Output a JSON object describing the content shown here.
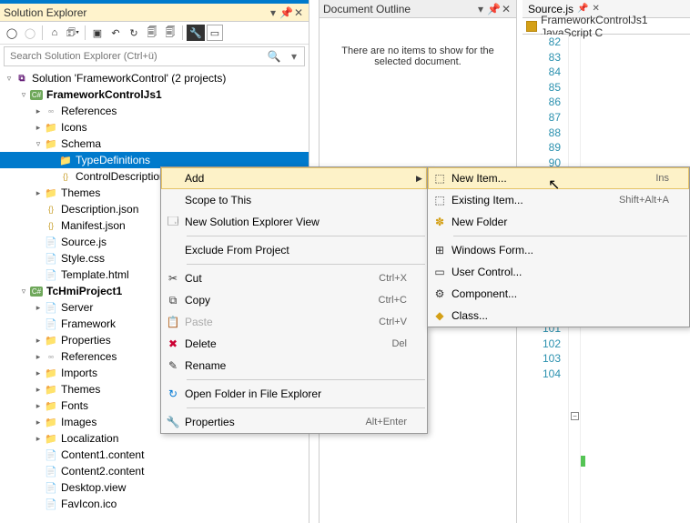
{
  "solutionExplorer": {
    "title": "Solution Explorer",
    "searchPlaceholder": "Search Solution Explorer (Ctrl+ü)",
    "solutionLabel": "Solution 'FrameworkControl' (2 projects)",
    "tree": [
      {
        "indent": 1,
        "exp": "▿",
        "iconClass": "proj-icon",
        "label": "FrameworkControlJs1",
        "bold": true
      },
      {
        "indent": 2,
        "exp": "▸",
        "iconClass": "ref-icon",
        "label": "References"
      },
      {
        "indent": 2,
        "exp": "▸",
        "iconClass": "folder-icon",
        "label": "Icons"
      },
      {
        "indent": 2,
        "exp": "▿",
        "iconClass": "folder-icon",
        "label": "Schema"
      },
      {
        "indent": 3,
        "exp": "",
        "iconClass": "folder-icon",
        "label": "TypeDefinitions",
        "selected": true
      },
      {
        "indent": 3,
        "exp": "",
        "iconClass": "brace-icon",
        "label": "ControlDescription"
      },
      {
        "indent": 2,
        "exp": "▸",
        "iconClass": "folder-icon",
        "label": "Themes"
      },
      {
        "indent": 2,
        "exp": "",
        "iconClass": "brace-icon",
        "label": "Description.json"
      },
      {
        "indent": 2,
        "exp": "",
        "iconClass": "brace-icon",
        "label": "Manifest.json"
      },
      {
        "indent": 2,
        "exp": "",
        "iconClass": "file-icon",
        "label": "Source.js"
      },
      {
        "indent": 2,
        "exp": "",
        "iconClass": "file-icon",
        "label": "Style.css"
      },
      {
        "indent": 2,
        "exp": "",
        "iconClass": "file-icon",
        "label": "Template.html"
      },
      {
        "indent": 1,
        "exp": "▿",
        "iconClass": "proj-icon",
        "label": "TcHmiProject1",
        "bold": true
      },
      {
        "indent": 2,
        "exp": "▸",
        "iconClass": "file-icon",
        "label": "Server"
      },
      {
        "indent": 2,
        "exp": "",
        "iconClass": "file-icon",
        "label": "Framework"
      },
      {
        "indent": 2,
        "exp": "▸",
        "iconClass": "folder-icon",
        "label": "Properties"
      },
      {
        "indent": 2,
        "exp": "▸",
        "iconClass": "ref-icon",
        "label": "References"
      },
      {
        "indent": 2,
        "exp": "▸",
        "iconClass": "folder-icon",
        "label": "Imports"
      },
      {
        "indent": 2,
        "exp": "▸",
        "iconClass": "folder-icon",
        "label": "Themes"
      },
      {
        "indent": 2,
        "exp": "▸",
        "iconClass": "folder-icon",
        "label": "Fonts"
      },
      {
        "indent": 2,
        "exp": "▸",
        "iconClass": "folder-icon",
        "label": "Images"
      },
      {
        "indent": 2,
        "exp": "▸",
        "iconClass": "folder-icon",
        "label": "Localization"
      },
      {
        "indent": 2,
        "exp": "",
        "iconClass": "file-icon",
        "label": "Content1.content"
      },
      {
        "indent": 2,
        "exp": "",
        "iconClass": "file-icon",
        "label": "Content2.content"
      },
      {
        "indent": 2,
        "exp": "",
        "iconClass": "file-icon",
        "label": "Desktop.view"
      },
      {
        "indent": 2,
        "exp": "",
        "iconClass": "file-icon",
        "label": "FavIcon.ico"
      }
    ]
  },
  "documentOutline": {
    "title": "Document Outline",
    "emptyText": "There are no items to show for the selected document."
  },
  "source": {
    "tabLabel": "Source.js",
    "dropdownLabel": "FrameworkControlJs1 JavaScript C",
    "lineStart": 82,
    "lineEnd": 104
  },
  "contextMenu1": [
    {
      "type": "item",
      "icon": "",
      "label": "Add",
      "shortcut": "",
      "arrow": "▶",
      "hovered": true
    },
    {
      "type": "item",
      "icon": "",
      "label": "Scope to This",
      "shortcut": ""
    },
    {
      "type": "item",
      "icon": "🗔",
      "label": "New Solution Explorer View",
      "shortcut": ""
    },
    {
      "type": "sep"
    },
    {
      "type": "item",
      "icon": "",
      "label": "Exclude From Project",
      "shortcut": ""
    },
    {
      "type": "sep"
    },
    {
      "type": "item",
      "icon": "✂",
      "label": "Cut",
      "shortcut": "Ctrl+X"
    },
    {
      "type": "item",
      "icon": "⧉",
      "label": "Copy",
      "shortcut": "Ctrl+C"
    },
    {
      "type": "item",
      "icon": "📋",
      "label": "Paste",
      "shortcut": "Ctrl+V",
      "disabled": true
    },
    {
      "type": "item",
      "icon": "✖",
      "label": "Delete",
      "shortcut": "Del",
      "iconColor": "#c03"
    },
    {
      "type": "item",
      "icon": "✎",
      "label": "Rename",
      "shortcut": ""
    },
    {
      "type": "sep"
    },
    {
      "type": "item",
      "icon": "↻",
      "label": "Open Folder in File Explorer",
      "shortcut": "",
      "iconColor": "#0078d4"
    },
    {
      "type": "sep"
    },
    {
      "type": "item",
      "icon": "🔧",
      "label": "Properties",
      "shortcut": "Alt+Enter"
    }
  ],
  "contextMenu2": [
    {
      "type": "item",
      "icon": "⬚",
      "label": "New Item...",
      "shortcut": "Ins",
      "hovered": true
    },
    {
      "type": "item",
      "icon": "⬚",
      "label": "Existing Item...",
      "shortcut": "Shift+Alt+A"
    },
    {
      "type": "item",
      "icon": "✽",
      "label": "New Folder",
      "shortcut": "",
      "iconColor": "#d4a017"
    },
    {
      "type": "sep"
    },
    {
      "type": "item",
      "icon": "⊞",
      "label": "Windows Form...",
      "shortcut": ""
    },
    {
      "type": "item",
      "icon": "▭",
      "label": "User Control...",
      "shortcut": ""
    },
    {
      "type": "item",
      "icon": "⚙",
      "label": "Component...",
      "shortcut": ""
    },
    {
      "type": "item",
      "icon": "◆",
      "label": "Class...",
      "shortcut": "",
      "iconColor": "#d4a017"
    }
  ]
}
